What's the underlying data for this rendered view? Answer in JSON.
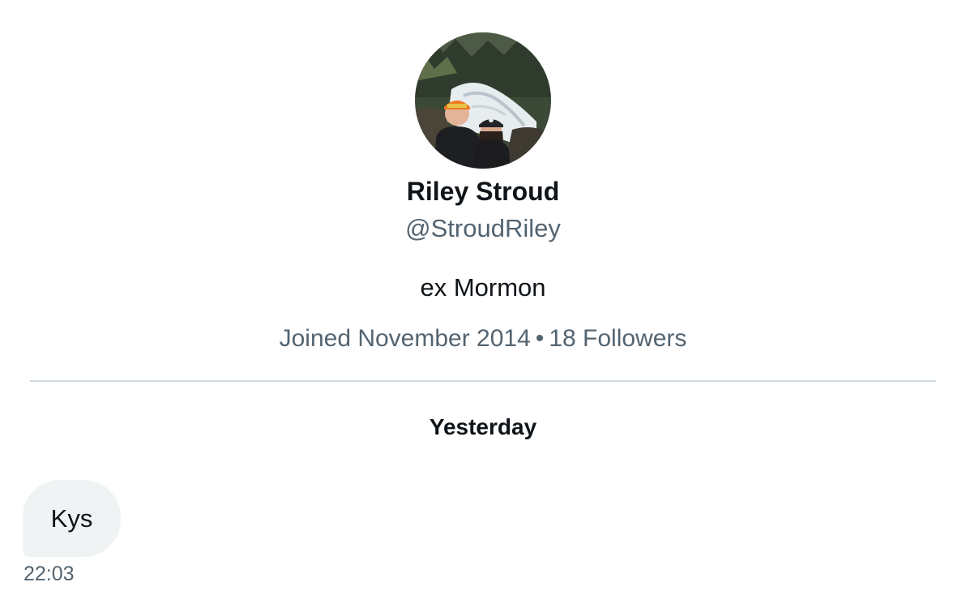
{
  "profile": {
    "avatar_icon": "profile-photo",
    "name": "Riley Stroud",
    "handle": "@StroudRiley",
    "bio": "ex Mormon",
    "joined": "Joined November 2014",
    "separator": "•",
    "followers": "18 Followers"
  },
  "conversation": {
    "date_label": "Yesterday",
    "messages": [
      {
        "text": "Kys",
        "time": "22:03"
      }
    ]
  },
  "colors": {
    "primary_text": "#0f1419",
    "secondary_text": "#536471",
    "divider": "#cfd9de",
    "bubble_bg": "#eff3f4"
  }
}
